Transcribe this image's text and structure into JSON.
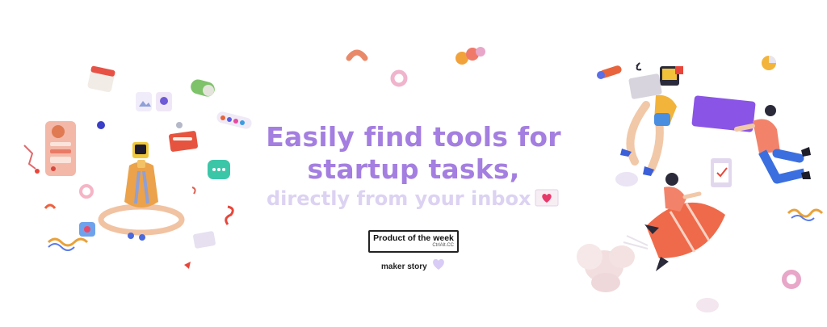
{
  "headline": {
    "line1": "Easily find tools for",
    "line2": "startup tasks,",
    "line3": "directly from your inbox"
  },
  "badge": {
    "title": "Product of the week",
    "subtitle": "CtrlAlt.CC"
  },
  "maker_story": {
    "label": "maker story"
  },
  "icons": {
    "mail": "envelope-heart-icon",
    "maker": "heart-icon"
  },
  "colors": {
    "headline": "#a47ee0",
    "subline": "#dcd2f2",
    "accent_purple": "#8a55e6",
    "accent_orange": "#f4724a"
  }
}
